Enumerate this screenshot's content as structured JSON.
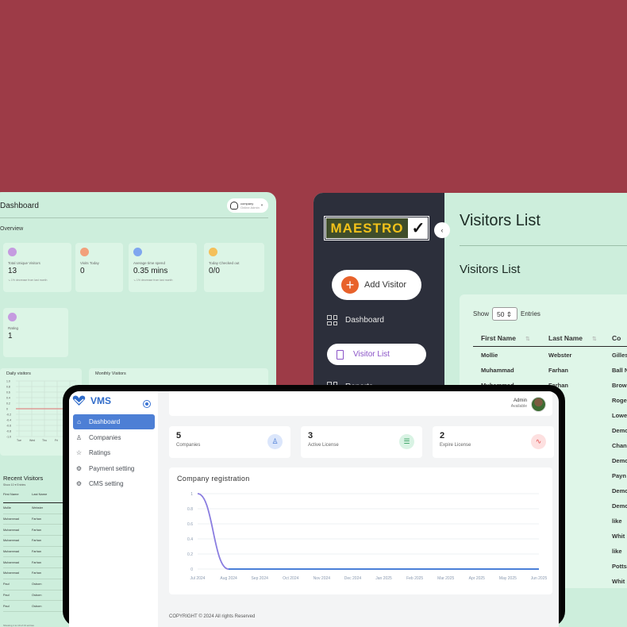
{
  "left_dashboard": {
    "title": "Dashboard",
    "user": {
      "name": "company",
      "status": "Online Admin"
    },
    "overview": "Overview",
    "stats": [
      {
        "label": "Total Unique Visitors",
        "value": "13",
        "note": "↘ 1% decrease from last month",
        "color": "#c59be0"
      },
      {
        "label": "Visits Today",
        "value": "0",
        "note": "",
        "color": "#f2a07b"
      },
      {
        "label": "Average time spend",
        "value": "0.35 mins",
        "note": "↘ 1% decrease from last month",
        "color": "#7fa6ef"
      },
      {
        "label": "Today Checked out",
        "value": "0/0",
        "note": "",
        "color": "#f4c05a"
      }
    ],
    "rating": {
      "label": "Rating",
      "value": "1",
      "color": "#c59be0"
    },
    "daily_title": "Daily visitors",
    "daily_y_ticks": [
      "1.0",
      "0.8",
      "0.6",
      "0.4",
      "0.2",
      "0",
      "-0.2",
      "-0.4",
      "-0.6",
      "-0.8",
      "-1.0"
    ],
    "daily_x_ticks": [
      "Tue",
      "Wed",
      "Thu",
      "Fri",
      "Sat"
    ],
    "monthly_title": "Monthly Visitors",
    "recent_title": "Recent Visitors",
    "recent_show": "Show 10 ▾ Entries",
    "recent_headers": [
      "First Name",
      "Last Name"
    ],
    "recent_rows": [
      [
        "Mollie",
        "Webster"
      ],
      [
        "Muhammad",
        "Farhan"
      ],
      [
        "Muhammad",
        "Farhan"
      ],
      [
        "Muhammad",
        "Farhan"
      ],
      [
        "Muhammad",
        "Farhan"
      ],
      [
        "Muhammad",
        "Farhan"
      ],
      [
        "Muhammad",
        "Farhan"
      ],
      [
        "Paul",
        "Osborn"
      ],
      [
        "Paul",
        "Osborn"
      ],
      [
        "Paul",
        "Osborn"
      ]
    ],
    "recent_footer": "Showing 1 to 10 of 13 entries"
  },
  "visitors_panel": {
    "logo": "MAESTRO",
    "collapse_icon": "chevron-left",
    "add_visitor": "Add Visitor",
    "nav": [
      {
        "label": "Dashboard",
        "icon": "grid-icon"
      },
      {
        "label": "Visitor List",
        "icon": "clipboard-icon",
        "active": true
      },
      {
        "label": "Reports",
        "icon": "doc-icon"
      }
    ],
    "page_title": "Visitors List",
    "section_title": "Visitors List",
    "show_label": "Show",
    "show_value": "50",
    "entries_label": "Entries",
    "columns": [
      "First Name",
      "Last Name",
      "Co"
    ],
    "rows": [
      [
        "Mollie",
        "Webster",
        "Gilles"
      ],
      [
        "Muhammad",
        "Farhan",
        "Ball N"
      ],
      [
        "Muhammad",
        "Farhan",
        "Brow"
      ],
      [
        "",
        "",
        "Roge"
      ],
      [
        "",
        "",
        "Lowe"
      ],
      [
        "",
        "",
        "Demo"
      ],
      [
        "",
        "",
        "Chan"
      ],
      [
        "",
        "",
        "Demo"
      ],
      [
        "",
        "",
        "Payn"
      ],
      [
        "",
        "",
        "Demo"
      ],
      [
        "",
        "",
        "Demo"
      ],
      [
        "",
        "",
        "like"
      ],
      [
        "",
        "",
        "Whit"
      ],
      [
        "",
        "",
        "like"
      ],
      [
        "",
        "",
        "Potts"
      ],
      [
        "",
        "",
        "Whit"
      ]
    ]
  },
  "vms": {
    "brand": "VMS",
    "nav": [
      {
        "label": "Dashboard",
        "icon": "home-icon",
        "active": true
      },
      {
        "label": "Companies",
        "icon": "user-icon"
      },
      {
        "label": "Ratings",
        "icon": "star-icon"
      },
      {
        "label": "Payment setting",
        "icon": "gear-icon"
      },
      {
        "label": "CMS setting",
        "icon": "gear-icon"
      }
    ],
    "user": {
      "name": "Admin",
      "status": "Available"
    },
    "cards": [
      {
        "value": "5",
        "label": "Companies",
        "icon": "user-icon",
        "color": "#dbe6fb",
        "icon_color": "#3f74d2"
      },
      {
        "value": "3",
        "label": "Active License",
        "icon": "server-icon",
        "color": "#d9f3e4",
        "icon_color": "#2f9c5a"
      },
      {
        "value": "2",
        "label": "Expire License",
        "icon": "pulse-icon",
        "color": "#fde0e0",
        "icon_color": "#e24b4b"
      }
    ],
    "chart_title": "Company registration",
    "footer": "COPYRIGHT © 2024  All rights Reserved"
  },
  "chart_data": {
    "type": "line",
    "title": "Company registration",
    "xlabel": "",
    "ylabel": "",
    "categories": [
      "Jul 2024",
      "Aug 2024",
      "Sep 2024",
      "Oct 2024",
      "Nov 2024",
      "Dec 2024",
      "Jan 2025",
      "Feb 2025",
      "Mar 2025",
      "Apr 2025",
      "May 2025",
      "Jun 2025"
    ],
    "y_ticks": [
      "1",
      "0.8",
      "0.6",
      "0.4",
      "0.2",
      "0"
    ],
    "series": [
      {
        "values": [
          1,
          0,
          0,
          0,
          0,
          0,
          0,
          0,
          0,
          0,
          0,
          0
        ],
        "color": "#8a7de0"
      }
    ],
    "ylim": [
      0,
      1
    ],
    "grid": true
  }
}
